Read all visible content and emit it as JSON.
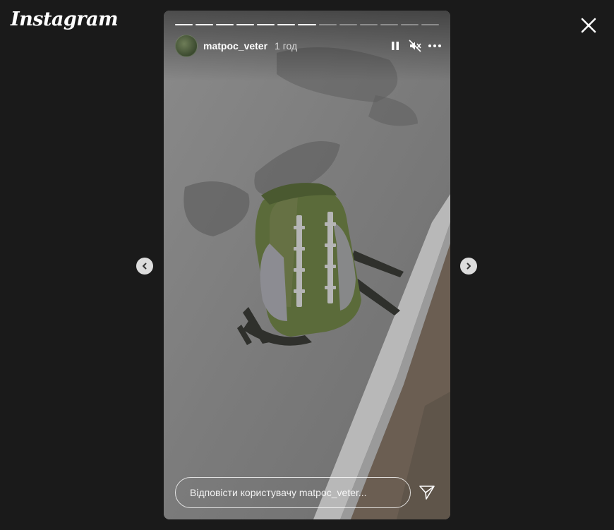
{
  "app": {
    "logo_text": "Instagram"
  },
  "story": {
    "username": "matpoc_veter",
    "time_ago": "1 год",
    "progress": {
      "total_segments": 13,
      "completed_segments": 7
    },
    "controls": {
      "pause_icon": "pause-icon",
      "mute_icon": "muted-speaker-icon",
      "more_icon": "more-options-icon"
    },
    "reply": {
      "placeholder": "Відповісти користувачу matpoc_veter..."
    },
    "image": {
      "subject": "backpack-on-asphalt"
    }
  },
  "colors": {
    "background": "#1a1a1a",
    "backpack_green": "#5b6b3a",
    "asphalt": "#7d7d7d"
  }
}
